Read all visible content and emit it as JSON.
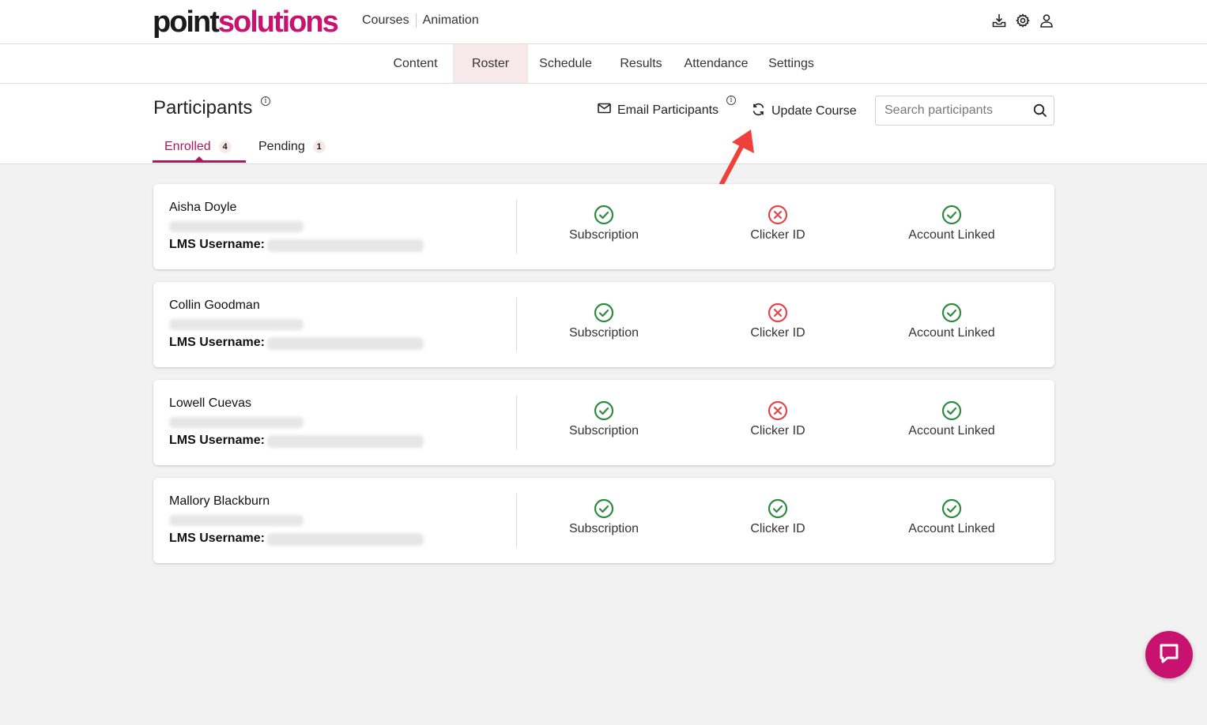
{
  "brand": {
    "part1": "point",
    "part2": "solutions"
  },
  "breadcrumb": {
    "courses": "Courses",
    "course_name": "Animation"
  },
  "nav": {
    "items": [
      {
        "label": "Content"
      },
      {
        "label": "Roster"
      },
      {
        "label": "Schedule"
      },
      {
        "label": "Results"
      },
      {
        "label": "Attendance"
      },
      {
        "label": "Settings"
      }
    ],
    "active": "Roster"
  },
  "page": {
    "title": "Participants",
    "email_label": "Email Participants",
    "update_label": "Update Course",
    "search_placeholder": "Search participants",
    "info_mark": "i"
  },
  "tabs": [
    {
      "label": "Enrolled",
      "count": "4"
    },
    {
      "label": "Pending",
      "count": "1"
    }
  ],
  "participants": [
    {
      "name": "Aisha Doyle",
      "lms_label": "LMS Username:",
      "subscription": "ok",
      "clicker": "missing",
      "account": "ok"
    },
    {
      "name": "Collin Goodman",
      "lms_label": "LMS Username:",
      "subscription": "ok",
      "clicker": "missing",
      "account": "ok"
    },
    {
      "name": "Lowell Cuevas",
      "lms_label": "LMS Username:",
      "subscription": "ok",
      "clicker": "missing",
      "account": "ok"
    },
    {
      "name": "Mallory Blackburn",
      "lms_label": "LMS Username:",
      "subscription": "ok",
      "clicker": "ok",
      "account": "ok"
    }
  ],
  "status_labels": {
    "subscription": "Subscription",
    "clicker": "Clicker ID",
    "account": "Account Linked"
  },
  "colors": {
    "brand": "#c8126f",
    "ok": "#2e8b3e",
    "missing": "#e0474c",
    "annotation_arrow": "#f0403c"
  }
}
